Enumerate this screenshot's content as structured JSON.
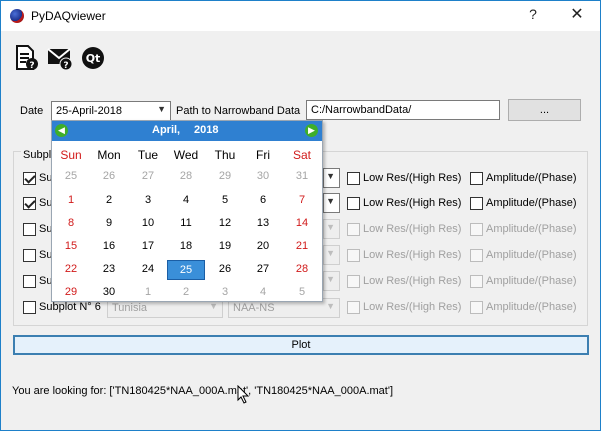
{
  "window": {
    "title": "PyDAQviewer",
    "help": "?",
    "close": "✕"
  },
  "toolbar": {
    "icons": [
      "document-help-icon",
      "mail-help-icon",
      "qt-about-icon"
    ],
    "qt_label": "Qt"
  },
  "form": {
    "date_label": "Date",
    "date_value": "25-April-2018",
    "path_label": "Path to Narrowband Data",
    "path_value": "C:/NarrowbandData/",
    "browse_label": "..."
  },
  "subplots": {
    "group_label": "Subpl",
    "rows": [
      {
        "label": "Su",
        "checked": true,
        "lowres": "Low Res/(High Res)",
        "amp": "Amplitude/(Phase)",
        "enabled": true
      },
      {
        "label": "Su",
        "checked": true,
        "lowres": "Low Res/(High Res)",
        "amp": "Amplitude/(Phase)",
        "enabled": true
      },
      {
        "label": "Su",
        "checked": false,
        "lowres": "Low Res/(High Res)",
        "amp": "Amplitude/(Phase)",
        "enabled": false
      },
      {
        "label": "Su",
        "checked": false,
        "lowres": "Low Res/(High Res)",
        "amp": "Amplitude/(Phase)",
        "enabled": false
      },
      {
        "label": "Su",
        "checked": false,
        "lowres": "Low Res/(High Res)",
        "amp": "Amplitude/(Phase)",
        "enabled": false
      },
      {
        "label": "Subplot N° 6",
        "checked": false,
        "lowres": "Low Res/(High Res)",
        "amp": "Amplitude/(Phase)",
        "enabled": false,
        "site": "Tunisia",
        "station": "NAA-NS"
      }
    ]
  },
  "calendar": {
    "month": "April,",
    "year": "2018",
    "weekdays": [
      "Sun",
      "Mon",
      "Tue",
      "Wed",
      "Thu",
      "Fri",
      "Sat"
    ],
    "weeks": [
      [
        "25",
        "26",
        "27",
        "28",
        "29",
        "30",
        "31"
      ],
      [
        "1",
        "2",
        "3",
        "4",
        "5",
        "6",
        "7"
      ],
      [
        "8",
        "9",
        "10",
        "11",
        "12",
        "13",
        "14"
      ],
      [
        "15",
        "16",
        "17",
        "18",
        "19",
        "20",
        "21"
      ],
      [
        "22",
        "23",
        "24",
        "25",
        "26",
        "27",
        "28"
      ],
      [
        "29",
        "30",
        "1",
        "2",
        "3",
        "4",
        "5"
      ]
    ],
    "selected_day": "25",
    "colors": {
      "header": "#2f80d1",
      "weekend": "#d11a1a",
      "selected": "#3a8fd9",
      "nav": "#3fae2a"
    }
  },
  "plot": {
    "label": "Plot"
  },
  "status": {
    "text": "You are looking for: ['TN180425*NAA_000A.mat', 'TN180425*NAA_000A.mat']"
  }
}
